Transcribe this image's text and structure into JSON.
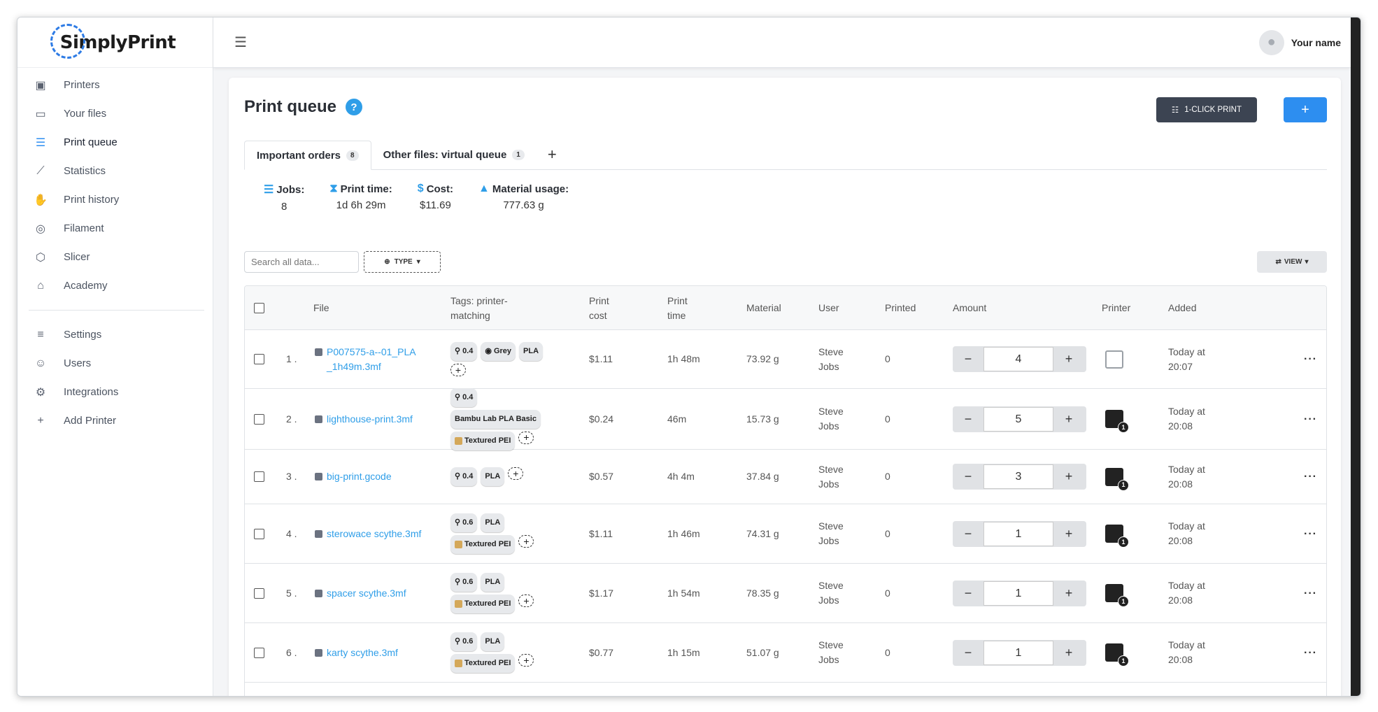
{
  "app": {
    "logo_text": "SimplyPrint",
    "user_name": "Your name"
  },
  "sidebar": {
    "items": [
      {
        "label": "Printers",
        "icon": "printer-icon"
      },
      {
        "label": "Your files",
        "icon": "folder-icon"
      },
      {
        "label": "Print queue",
        "icon": "list-icon",
        "active": true
      },
      {
        "label": "Statistics",
        "icon": "chart-icon"
      },
      {
        "label": "Print history",
        "icon": "history-icon"
      },
      {
        "label": "Filament",
        "icon": "filament-icon"
      },
      {
        "label": "Slicer",
        "icon": "cube-icon"
      },
      {
        "label": "Academy",
        "icon": "graduation-icon"
      }
    ],
    "items2": [
      {
        "label": "Settings",
        "icon": "sliders-icon"
      },
      {
        "label": "Users",
        "icon": "users-icon"
      },
      {
        "label": "Integrations",
        "icon": "gears-icon"
      },
      {
        "label": "Add Printer",
        "icon": "plus-icon"
      }
    ]
  },
  "page": {
    "title": "Print queue",
    "help": "?",
    "oneclick_label": "1-CLICK PRINT",
    "add_label": "+"
  },
  "tabs": [
    {
      "label": "Important orders",
      "badge": "8"
    },
    {
      "label": "Other files: virtual queue",
      "badge": "1"
    }
  ],
  "tab_add": "+",
  "stats": [
    {
      "label": "Jobs:",
      "value": "8",
      "icon": "list-icon"
    },
    {
      "label": "Print time:",
      "value": "1d 6h 29m",
      "icon": "hourglass-icon"
    },
    {
      "label": "Cost:",
      "value": "$11.69",
      "icon": "dollar-icon"
    },
    {
      "label": "Material usage:",
      "value": "777.63 g",
      "icon": "weight-icon"
    }
  ],
  "filters": {
    "search_placeholder": "Search all data...",
    "type_label": "TYPE",
    "view_label": "VIEW"
  },
  "table": {
    "headers": {
      "file": "File",
      "tags": "Tags: printer-matching",
      "cost": "Print cost",
      "time": "Print time",
      "material": "Material",
      "user": "User",
      "printed": "Printed",
      "amount": "Amount",
      "printer": "Printer",
      "added": "Added"
    },
    "rows": [
      {
        "num": "1 .",
        "file": "P007575-a--01_PLA_1h49m.3mf",
        "tags": [
          "0.4",
          "Grey",
          "PLA"
        ],
        "cost": "$1.11",
        "time": "1h 48m",
        "material": "73.92 g",
        "user": "Steve Jobs",
        "printed": "0",
        "amount": "4",
        "printer_count": "",
        "added": "Today at 20:07"
      },
      {
        "num": "2 .",
        "file": "lighthouse-print.3mf",
        "tags": [
          "0.4",
          "Bambu Lab PLA Basic",
          "Textured PEI"
        ],
        "cost": "$0.24",
        "time": "46m",
        "material": "15.73 g",
        "user": "Steve Jobs",
        "printed": "0",
        "amount": "5",
        "printer_count": "1",
        "added": "Today at 20:08"
      },
      {
        "num": "3 .",
        "file": "big-print.gcode",
        "tags": [
          "0.4",
          "PLA"
        ],
        "cost": "$0.57",
        "time": "4h 4m",
        "material": "37.84 g",
        "user": "Steve Jobs",
        "printed": "0",
        "amount": "3",
        "printer_count": "1",
        "added": "Today at 20:08"
      },
      {
        "num": "4 .",
        "file": "sterowace scythe.3mf",
        "tags": [
          "0.6",
          "PLA",
          "Textured PEI"
        ],
        "cost": "$1.11",
        "time": "1h 46m",
        "material": "74.31 g",
        "user": "Steve Jobs",
        "printed": "0",
        "amount": "1",
        "printer_count": "1",
        "added": "Today at 20:08"
      },
      {
        "num": "5 .",
        "file": "spacer scythe.3mf",
        "tags": [
          "0.6",
          "PLA",
          "Textured PEI"
        ],
        "cost": "$1.17",
        "time": "1h 54m",
        "material": "78.35 g",
        "user": "Steve Jobs",
        "printed": "0",
        "amount": "1",
        "printer_count": "1",
        "added": "Today at 20:08"
      },
      {
        "num": "6 .",
        "file": "karty scythe.3mf",
        "tags": [
          "0.6",
          "PLA",
          "Textured PEI"
        ],
        "cost": "$0.77",
        "time": "1h 15m",
        "material": "51.07 g",
        "user": "Steve Jobs",
        "printed": "0",
        "amount": "1",
        "printer_count": "1",
        "added": "Today at 20:08"
      }
    ]
  },
  "colors": {
    "accent": "#2d8ef0",
    "dark_button": "#3c4452",
    "link": "#2f9ee8"
  }
}
